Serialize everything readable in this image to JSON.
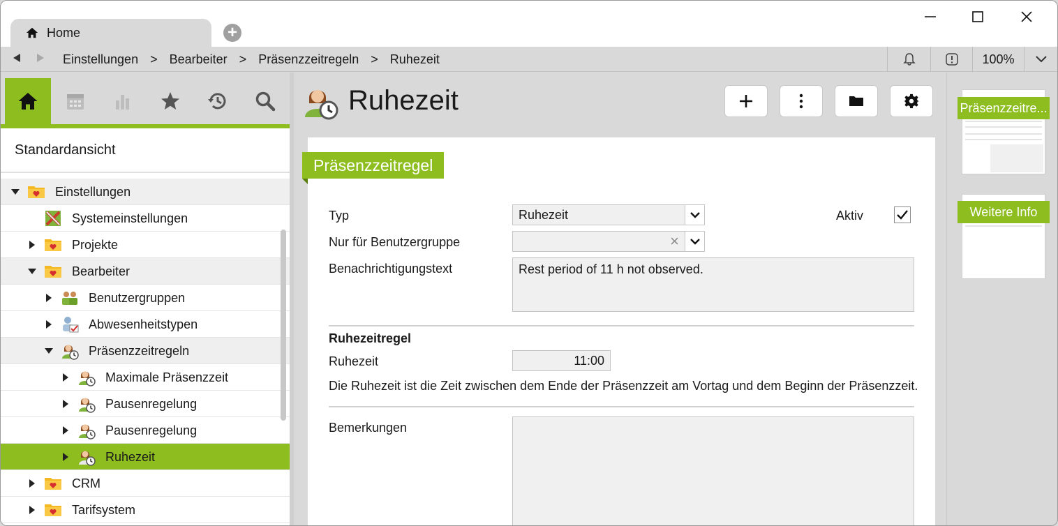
{
  "titlebar": {
    "tab_label": "Home",
    "new_tab_symbol": "+"
  },
  "addressbar": {
    "crumbs": [
      "Einstellungen",
      "Bearbeiter",
      "Präsenzzeitregeln",
      "Ruhezeit"
    ],
    "separator": ">",
    "zoom": "100%"
  },
  "leftpanel": {
    "view_label": "Standardansicht",
    "tabs": [
      "home-icon",
      "calendar-icon",
      "chart-icon",
      "star-icon",
      "history-icon",
      "search-icon"
    ],
    "tree": [
      {
        "label": "Einstellungen"
      },
      {
        "label": "Systemeinstellungen"
      },
      {
        "label": "Projekte"
      },
      {
        "label": "Bearbeiter"
      },
      {
        "label": "Benutzergruppen"
      },
      {
        "label": "Abwesenheitstypen"
      },
      {
        "label": "Präsenzzeitregeln"
      },
      {
        "label": "Maximale Präsenzzeit"
      },
      {
        "label": "Pausenregelung"
      },
      {
        "label": "Pausenregelung"
      },
      {
        "label": "Ruhezeit"
      },
      {
        "label": "CRM"
      },
      {
        "label": "Tarifsystem"
      }
    ]
  },
  "main": {
    "title": "Ruhezeit",
    "section_title": "Präsenzzeitregel",
    "fields": {
      "typ_label": "Typ",
      "typ_value": "Ruhezeit",
      "aktiv_label": "Aktiv",
      "aktiv_checked": true,
      "gruppe_label": "Nur für Benutzergruppe",
      "gruppe_value": "",
      "clear_symbol": "×",
      "benachrichtigung_label": "Benachrichtigungstext",
      "benachrichtigung_value": "Rest period of 11 h not observed.",
      "rule_heading": "Ruhezeitregel",
      "ruhezeit_label": "Ruhezeit",
      "ruhezeit_value": "11:00",
      "description": "Die Ruhezeit ist die Zeit zwischen dem Ende der Präsenzzeit am Vortag und dem Beginn der Präsenzzeit.",
      "bemerkungen_label": "Bemerkungen",
      "bemerkungen_value": ""
    }
  },
  "rightpanel": {
    "thumb1_label": "Präsenzzeitre...",
    "thumb2_label": "Weitere Info"
  },
  "colors": {
    "accent": "#8dbd1f",
    "background": "#d9d9d9"
  }
}
